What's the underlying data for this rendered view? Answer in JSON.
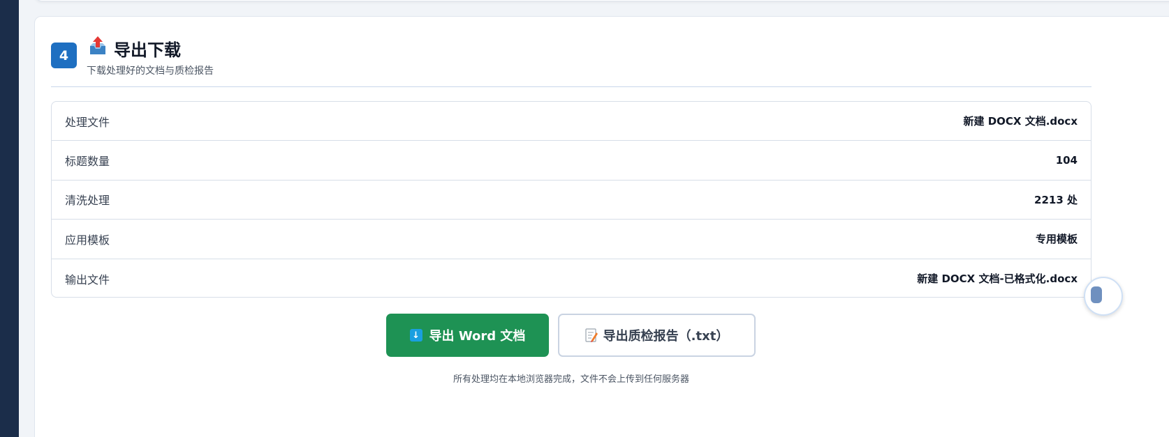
{
  "section": {
    "step_number": "4",
    "title_icon": "outbox-tray-icon",
    "title": "导出下载",
    "subtitle": "下载处理好的文档与质检报告"
  },
  "summary_rows": [
    {
      "label": "处理文件",
      "value": "新建 DOCX 文档.docx"
    },
    {
      "label": "标题数量",
      "value": "104"
    },
    {
      "label": "清洗处理",
      "value": "2213 处"
    },
    {
      "label": "应用模板",
      "value": "专用模板"
    },
    {
      "label": "输出文件",
      "value": "新建 DOCX 文档-已格式化.docx"
    }
  ],
  "actions": {
    "export_word": {
      "icon": "download-arrow-icon",
      "label": "导出 Word 文档"
    },
    "export_report": {
      "icon": "memo-icon",
      "label": "导出质检报告（.txt）"
    }
  },
  "footnote": "所有处理均在本地浏览器完成，文件不会上传到任何服务器",
  "colors": {
    "accent_blue": "#1e6fc1",
    "primary_green": "#1e9254",
    "sidebar_dark": "#1b2d4a"
  }
}
